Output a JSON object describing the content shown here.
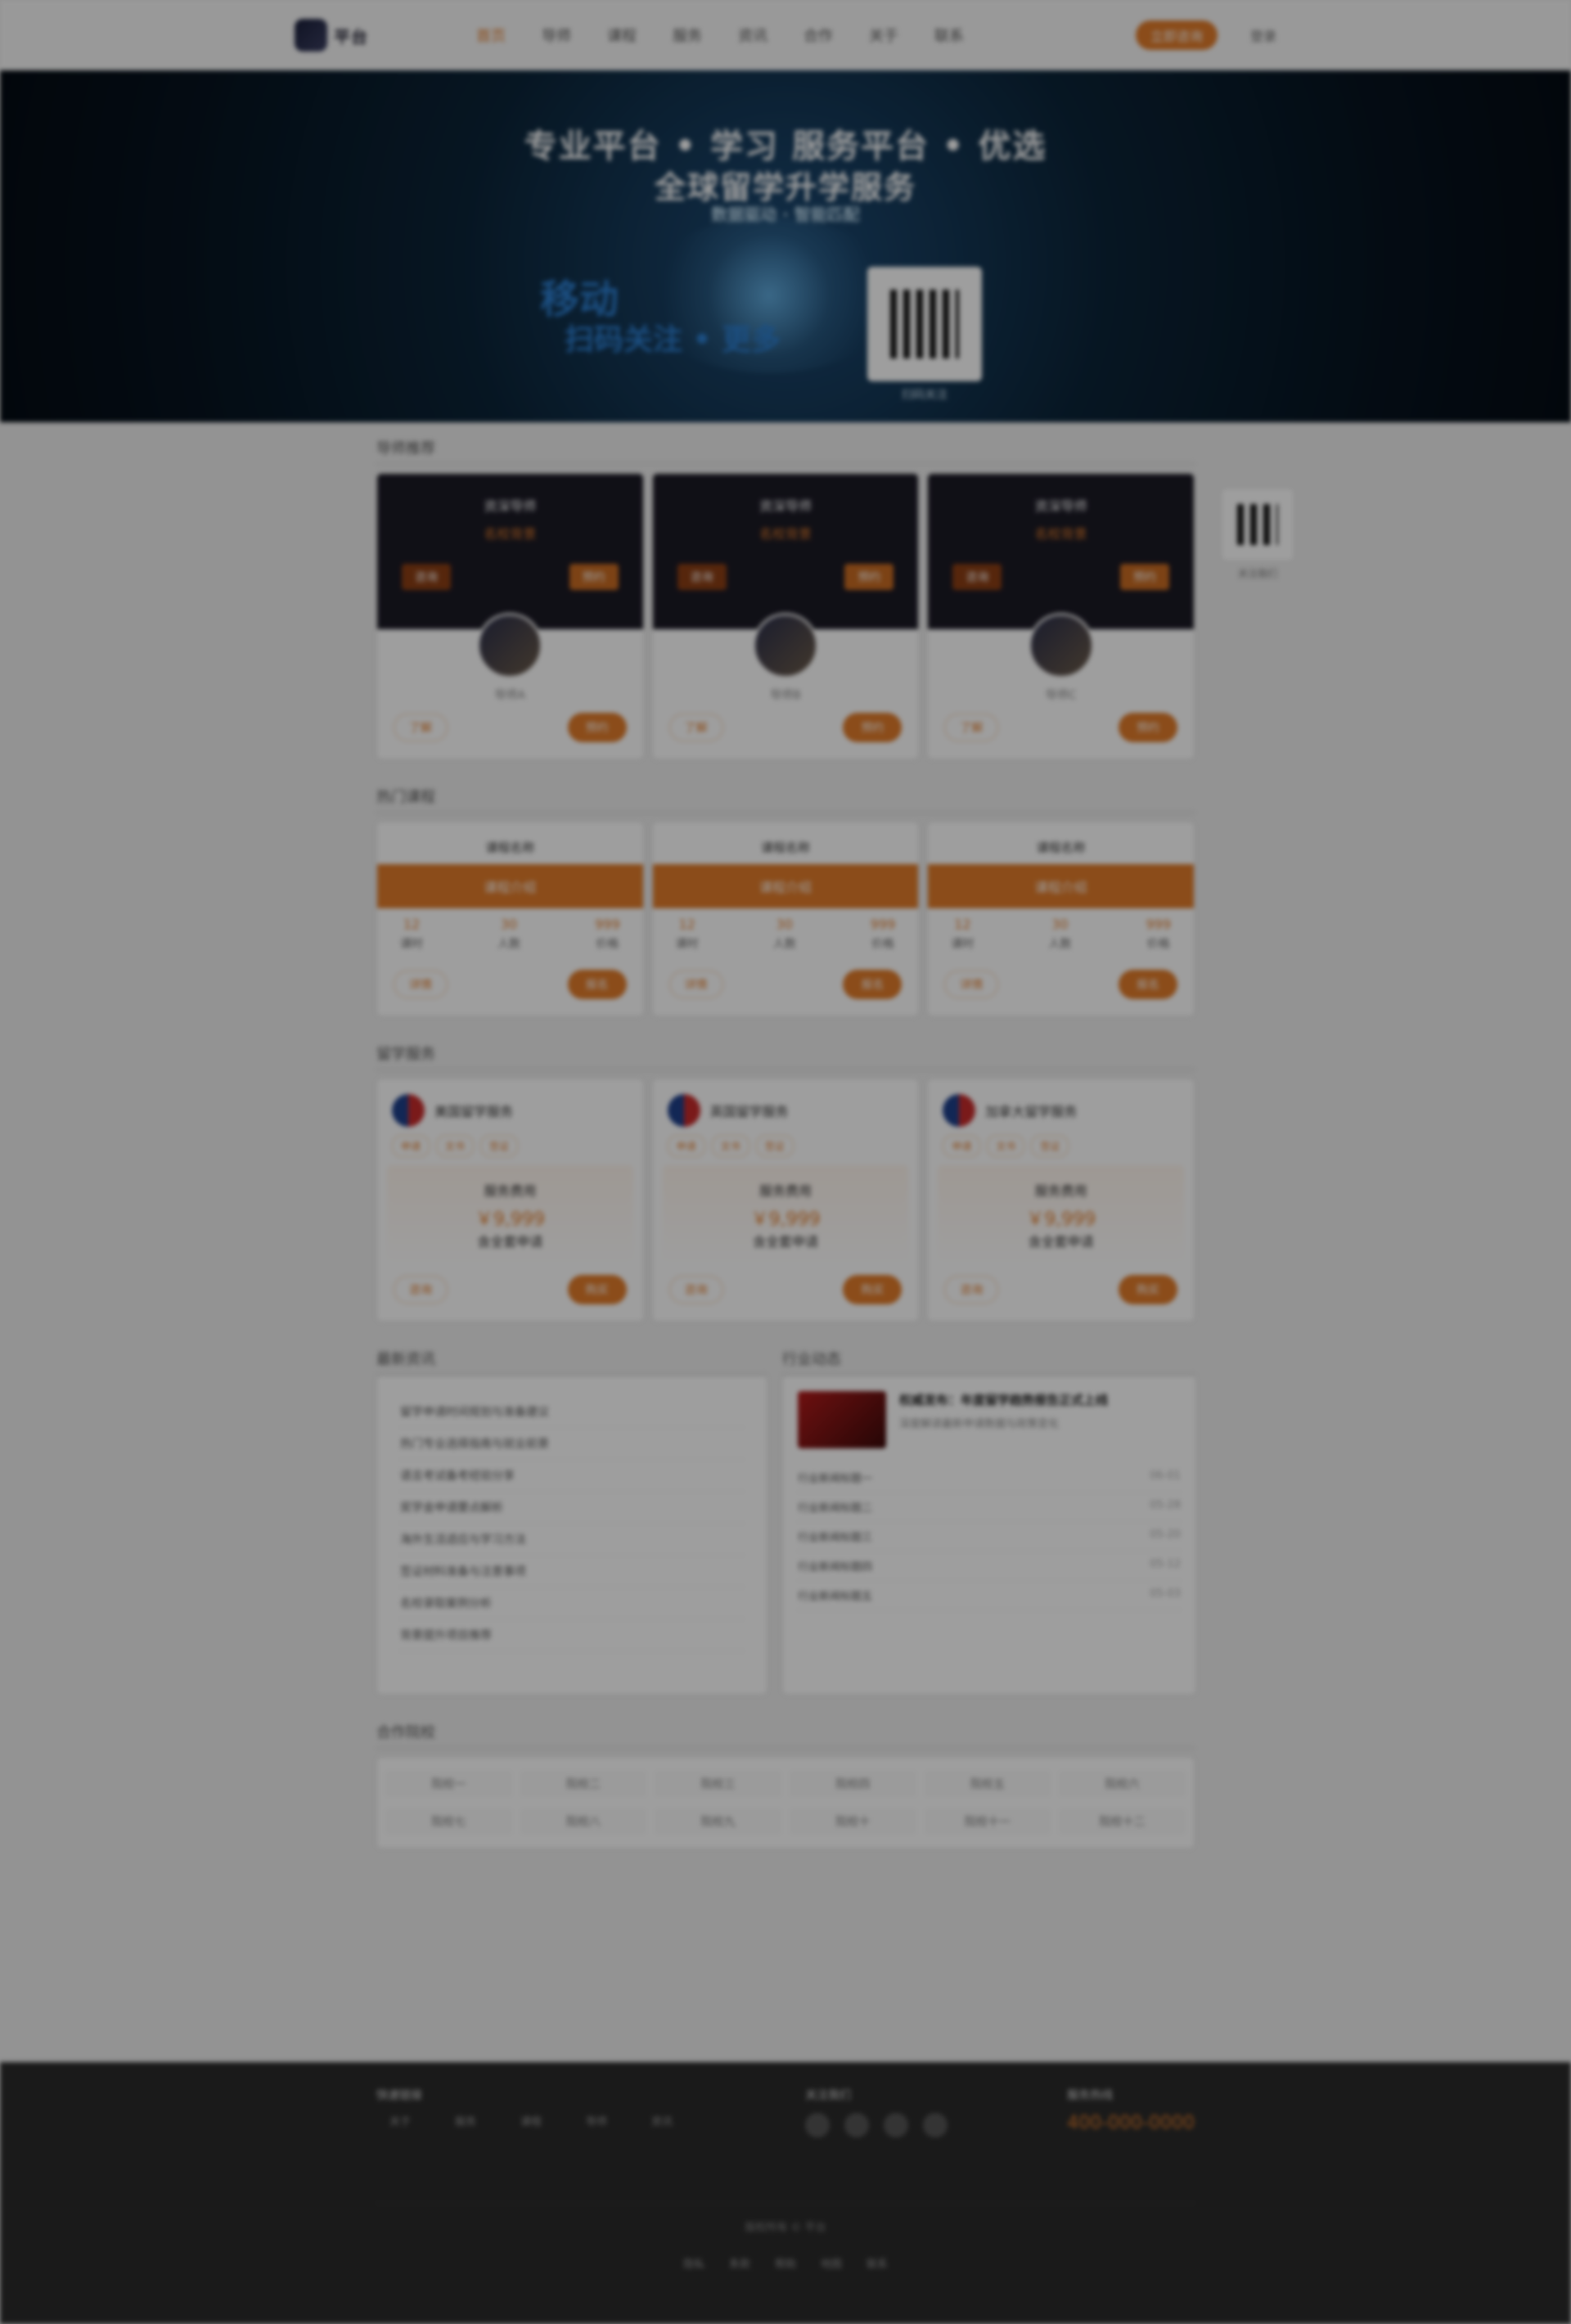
{
  "header": {
    "logo_text": "平台",
    "nav": [
      "首页",
      "导师",
      "课程",
      "服务",
      "资讯",
      "合作",
      "关于",
      "联系"
    ],
    "cta_label": "立即咨询",
    "user_link": "登录"
  },
  "banner": {
    "headline_1": "专业平台 • 学习 服务平台 • 优选",
    "headline_2": "全球留学升学服务",
    "subline": "数据驱动 · 智能匹配",
    "left_big_1": "移动",
    "left_big_2": "扫码关注 • 更多",
    "qr_label": "扫码关注"
  },
  "sections": {
    "mentors_title": "导师推荐",
    "courses_title": "热门课程",
    "services_title": "留学服务",
    "info_title": "最新资讯",
    "news_title": "行业动态",
    "partners_title": "合作院校"
  },
  "mentors": [
    {
      "dark_title": "资深导师",
      "dark_sub": "名校背景",
      "chip_left": "咨询",
      "chip_right": "预约",
      "name": "导师A",
      "btn_ghost": "了解",
      "btn_solid": "预约"
    },
    {
      "dark_title": "资深导师",
      "dark_sub": "名校背景",
      "chip_left": "咨询",
      "chip_right": "预约",
      "name": "导师B",
      "btn_ghost": "了解",
      "btn_solid": "预约"
    },
    {
      "dark_title": "资深导师",
      "dark_sub": "名校背景",
      "chip_left": "咨询",
      "chip_right": "预约",
      "name": "导师C",
      "btn_ghost": "了解",
      "btn_solid": "预约"
    }
  ],
  "courses": [
    {
      "top": "课程名称",
      "bar": "课程介绍",
      "s1": "课时",
      "s1n": "12",
      "s2": "人数",
      "s2n": "30",
      "s3": "价格",
      "s3n": "999",
      "btn_ghost": "详情",
      "btn_solid": "报名"
    },
    {
      "top": "课程名称",
      "bar": "课程介绍",
      "s1": "课时",
      "s1n": "12",
      "s2": "人数",
      "s2n": "30",
      "s3": "价格",
      "s3n": "999",
      "btn_ghost": "详情",
      "btn_solid": "报名"
    },
    {
      "top": "课程名称",
      "bar": "课程介绍",
      "s1": "课时",
      "s1n": "12",
      "s2": "人数",
      "s2n": "30",
      "s3": "价格",
      "s3n": "999",
      "btn_ghost": "详情",
      "btn_solid": "报名"
    }
  ],
  "services": [
    {
      "title": "美国留学服务",
      "tags": [
        "申请",
        "文书",
        "签证"
      ],
      "label": "服务费用",
      "price": "￥9,999",
      "desc": "含全套申请",
      "btn_ghost": "咨询",
      "btn_solid": "购买"
    },
    {
      "title": "英国留学服务",
      "tags": [
        "申请",
        "文书",
        "签证"
      ],
      "label": "服务费用",
      "price": "￥9,999",
      "desc": "含全套申请",
      "btn_ghost": "咨询",
      "btn_solid": "购买"
    },
    {
      "title": "加拿大留学服务",
      "tags": [
        "申请",
        "文书",
        "签证"
      ],
      "label": "服务费用",
      "price": "￥9,999",
      "desc": "含全套申请",
      "btn_ghost": "咨询",
      "btn_solid": "购买"
    }
  ],
  "info_list": [
    "留学申请时间规划与准备建议",
    "热门专业选择指南与就业前景",
    "语言考试备考经验分享",
    "奖学金申请要点解析",
    "海外生活适应与学习方法",
    "签证材料准备与注意事项",
    "名校录取案例分析",
    "背景提升项目推荐"
  ],
  "news": {
    "headline": "权威发布：年度留学趋势报告正式上线",
    "sub": "深度解读最新申请数据与政策变化",
    "rows": [
      {
        "text": "行业新闻标题一",
        "date": "06-01"
      },
      {
        "text": "行业新闻标题二",
        "date": "05-28"
      },
      {
        "text": "行业新闻标题三",
        "date": "05-20"
      },
      {
        "text": "行业新闻标题四",
        "date": "05-12"
      },
      {
        "text": "行业新闻标题五",
        "date": "05-03"
      }
    ]
  },
  "partners": [
    "院校一",
    "院校二",
    "院校三",
    "院校四",
    "院校五",
    "院校六",
    "院校七",
    "院校八",
    "院校九",
    "院校十",
    "院校十一",
    "院校十二"
  ],
  "side": {
    "label": "关注我们"
  },
  "footer": {
    "col1_title": "快速链接",
    "links": [
      "关于",
      "服务",
      "课程",
      "导师",
      "资讯"
    ],
    "col2_title": "关注我们",
    "col3_title": "服务热线",
    "phone": "400-000-0000",
    "copyright": "版权所有 © 平台",
    "bottom_links": [
      "隐私",
      "条款",
      "帮助",
      "地图",
      "联系"
    ]
  }
}
